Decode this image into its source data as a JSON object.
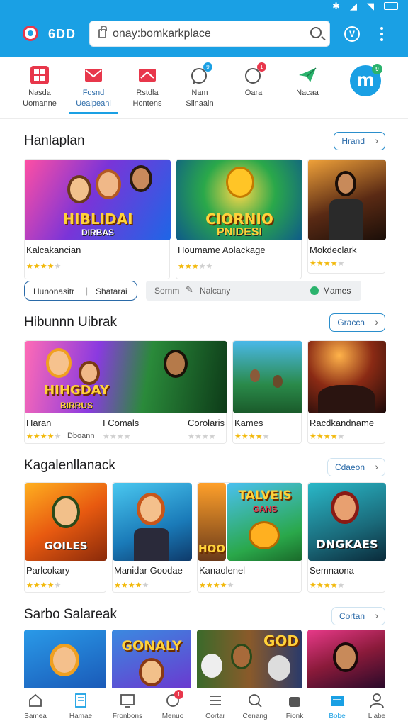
{
  "status_bar": {
    "icons": [
      "bluetooth-icon",
      "signal-icon",
      "wifi-icon",
      "battery-icon"
    ]
  },
  "header": {
    "app_name": "6DD",
    "url": "onay:bomkarkplace",
    "accent_color": "#1aa0e4"
  },
  "categories": [
    {
      "line1": "Nasda",
      "line2": "Uomanne",
      "icon": "grid-app-icon",
      "color": "#e8374b"
    },
    {
      "line1": "Fosnd",
      "line2": "Uealpeanl",
      "icon": "envelope-icon",
      "color": "#e8374b",
      "active": true
    },
    {
      "line1": "Rstdla",
      "line2": "Hontens",
      "icon": "mail-flag-icon",
      "color": "#e8374b"
    },
    {
      "line1": "Nam",
      "line2": "Slinaain",
      "icon": "chat-bubble-icon",
      "color": "#555555"
    },
    {
      "line1": "Oara",
      "line2": "",
      "icon": "chat-bubble-icon",
      "color": "#555555"
    },
    {
      "line1": "Nacaa",
      "line2": "",
      "icon": "send-icon",
      "color": "#2bb36d"
    },
    {
      "line1": "",
      "line2": "",
      "icon": "m-brand-logo",
      "color": "#1aa0e4"
    }
  ],
  "category_badges": {
    "nam": "9",
    "oara": "1",
    "brand": "9"
  },
  "sections": [
    {
      "title": "Hanlaplan",
      "more_label": "Hrand",
      "cards": [
        {
          "title": "Kalcakancian",
          "rating": 4,
          "thumb_title": "HIBLIDAI",
          "thumb_sub": "DIRBAS"
        },
        {
          "title": "Houmame Aolackage",
          "rating": 3,
          "thumb_title": "CIORNIO",
          "thumb_sub": "PNIDESI"
        },
        {
          "title": "Mokdeclark",
          "rating": 4,
          "thumb_title": "",
          "thumb_sub": ""
        }
      ]
    },
    {
      "title": "Hibunnn Uibrak",
      "more_label": "Gracca",
      "cards": [
        {
          "title": "Haran",
          "rating": 4,
          "extra": "Dboann",
          "thumb_title": "HIHGDAY",
          "thumb_sub": "BIRRUS"
        },
        {
          "title": "I Comals",
          "rating": 0,
          "thumb_title": "",
          "thumb_sub": ""
        },
        {
          "title": "Corolaris",
          "rating": 0,
          "thumb_title": "",
          "thumb_sub": ""
        },
        {
          "title": "Kames",
          "rating": 4,
          "thumb_title": "",
          "thumb_sub": ""
        },
        {
          "title": "Racdkandname",
          "rating": 4,
          "thumb_title": "",
          "thumb_sub": ""
        }
      ]
    },
    {
      "title": "Kagalenllanack",
      "more_label": "Cdaeon",
      "cards": [
        {
          "title": "Parlcokary",
          "rating": 4,
          "thumb_title": "GOILES",
          "thumb_sub": ""
        },
        {
          "title": "Manidar Goodae",
          "rating": 4,
          "thumb_title": "",
          "thumb_sub": ""
        },
        {
          "title": "Kanaolenel",
          "rating": 4,
          "thumb_title": "HOO",
          "thumb_sub": ""
        },
        {
          "title": "",
          "rating": 0,
          "thumb_title": "TALVEIS",
          "thumb_sub": "GANS"
        },
        {
          "title": "Semnaona",
          "rating": 4,
          "thumb_title": "DNGKAES",
          "thumb_sub": ""
        }
      ]
    },
    {
      "title": "Sarbo Salareak",
      "more_label": "Cortan",
      "cards": [
        {
          "title": "",
          "rating": 0,
          "thumb_title": "",
          "thumb_sub": ""
        },
        {
          "title": "",
          "rating": 0,
          "thumb_title": "GONALY",
          "thumb_sub": ""
        },
        {
          "title": "",
          "rating": 0,
          "thumb_title": "GOD",
          "thumb_sub": ""
        },
        {
          "title": "",
          "rating": 0,
          "thumb_title": "",
          "thumb_sub": ""
        }
      ]
    }
  ],
  "filters": {
    "chip1_a": "Hunonasitr",
    "chip1_b": "Shatarai",
    "chip2_a": "Sornm",
    "chip2_b": "Nalcany",
    "chip2_c": "Mames"
  },
  "tabs": [
    {
      "label": "Samea",
      "icon": "home-icon"
    },
    {
      "label": "Hamae",
      "icon": "book-icon"
    },
    {
      "label": "Fronbons",
      "icon": "tv-icon"
    },
    {
      "label": "Menuo",
      "icon": "chat-icon",
      "badge": "1"
    },
    {
      "label": "Cortar",
      "icon": "list-icon"
    },
    {
      "label": "Cenang",
      "icon": "search-icon"
    },
    {
      "label": "Fionk",
      "icon": "bag-icon"
    },
    {
      "label": "Bobe",
      "icon": "store-icon",
      "active": true
    },
    {
      "label": "Liabe",
      "icon": "person-icon"
    }
  ]
}
